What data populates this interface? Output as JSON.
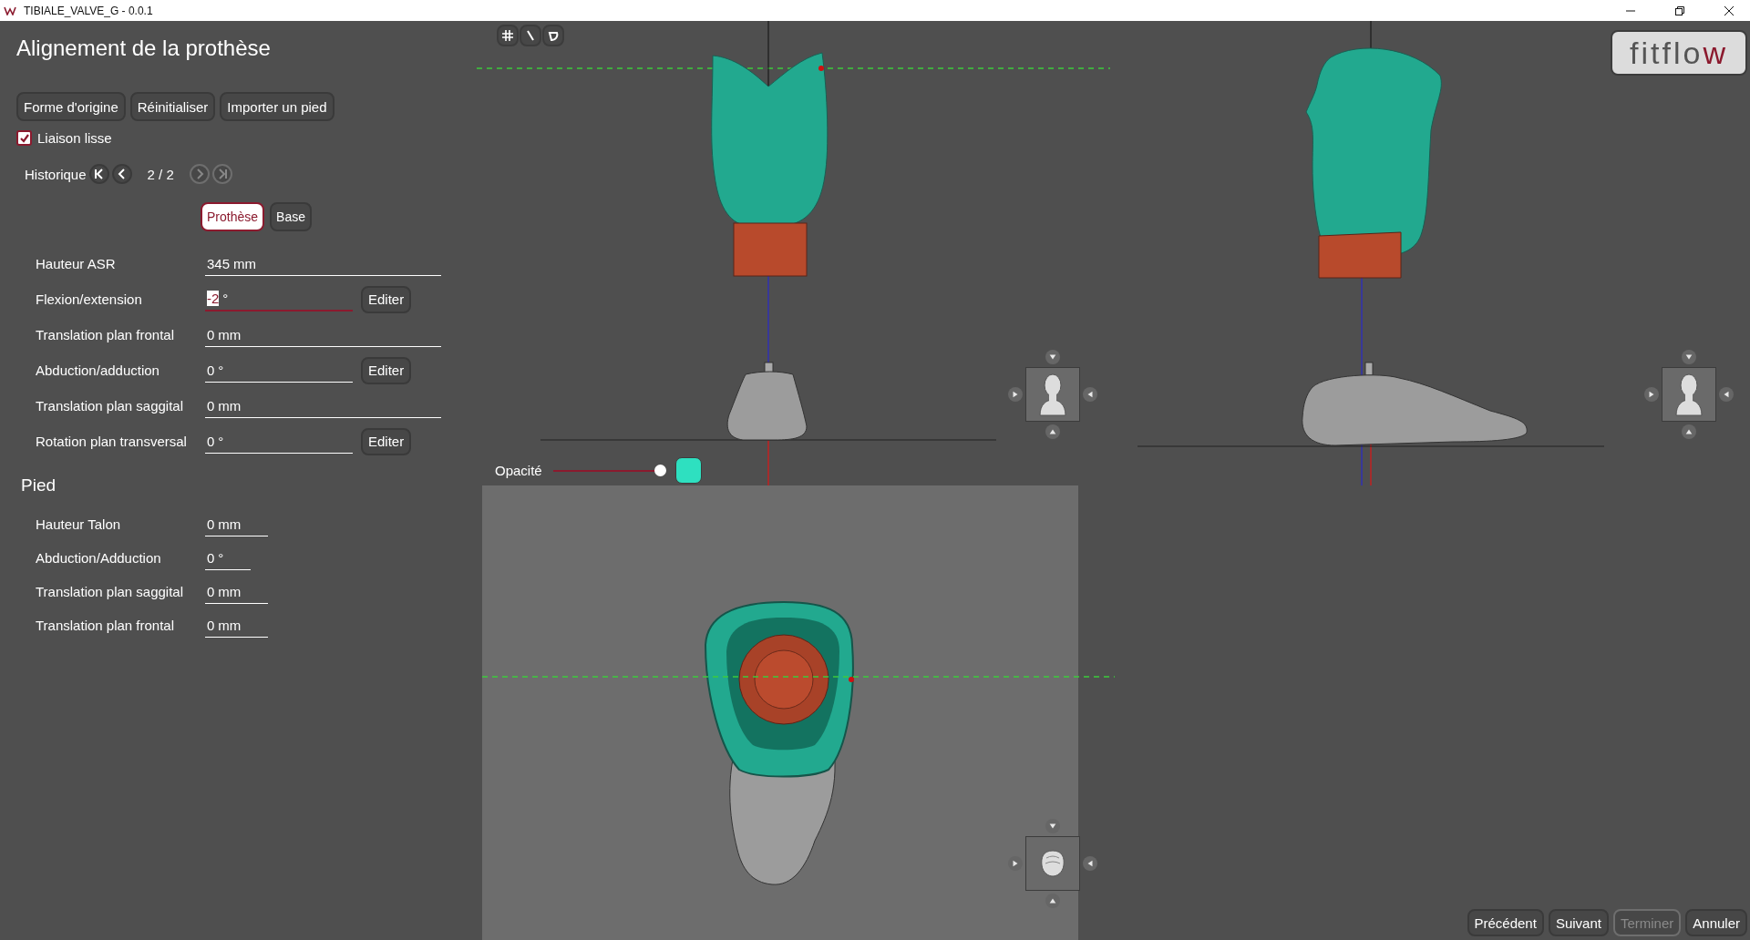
{
  "window": {
    "title": "TIBIALE_VALVE_G - 0.0.1"
  },
  "panel": {
    "title": "Alignement de la prothèse",
    "actions": [
      "Forme d'origine",
      "Réinitialiser",
      "Importer un pied"
    ],
    "smooth_link": {
      "label": "Liaison lisse",
      "checked": true
    },
    "history": {
      "label": "Historique",
      "position": "2 / 2",
      "nav": [
        {
          "kind": "first",
          "disabled": false
        },
        {
          "kind": "previous",
          "disabled": false
        },
        {
          "kind": "next",
          "disabled": true
        },
        {
          "kind": "last",
          "disabled": true
        }
      ]
    },
    "tabs": [
      {
        "label": "Prothèse",
        "selected": true
      },
      {
        "label": "Base",
        "selected": false
      }
    ],
    "prosthesis_fields": [
      {
        "label": "Hauteur ASR",
        "value": "345",
        "unit": "mm",
        "focused": false
      },
      {
        "label": "Flexion/extension",
        "value": "-2",
        "unit": "°",
        "focused": true,
        "button": "Editer"
      },
      {
        "label": "Translation plan frontal",
        "value": "0",
        "unit": "mm",
        "focused": false
      },
      {
        "label": "Abduction/adduction",
        "value": "0",
        "unit": "°",
        "focused": false,
        "button": "Editer"
      },
      {
        "label": "Translation plan saggital",
        "value": "0",
        "unit": "mm",
        "focused": false
      },
      {
        "label": "Rotation plan transversal",
        "value": "0",
        "unit": "°",
        "focused": false,
        "button": "Editer"
      }
    ],
    "foot": {
      "title": "Pied",
      "fields": [
        {
          "label": "Hauteur Talon",
          "value": "0",
          "unit": "mm"
        },
        {
          "label": "Abduction/Adduction",
          "value": "0",
          "unit": "°"
        },
        {
          "label": "Translation plan saggital",
          "value": "0",
          "unit": "mm"
        },
        {
          "label": "Translation plan frontal",
          "value": "0",
          "unit": "mm"
        }
      ]
    }
  },
  "viewer": {
    "logo": "fitflow",
    "opacity": {
      "label": "Opacité",
      "level": 1,
      "color": "#2ee0c0"
    }
  },
  "footer_buttons": [
    {
      "label": "Précédent",
      "disabled": false
    },
    {
      "label": "Suivant",
      "disabled": false
    },
    {
      "label": "Terminer",
      "disabled": true
    },
    {
      "label": "Annuler",
      "disabled": false
    }
  ]
}
